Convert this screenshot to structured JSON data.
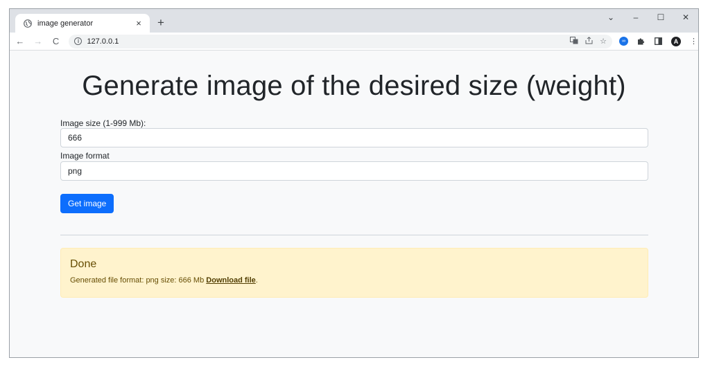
{
  "browser": {
    "tab": {
      "title": "image generator",
      "close": "×"
    },
    "new_tab": "+",
    "window_controls": {
      "dropdown": "⌄",
      "minimize": "–",
      "maximize": "☐",
      "close": "✕"
    },
    "nav": {
      "back": "←",
      "forward": "→",
      "reload": "C"
    },
    "url": "127.0.0.1",
    "profile_initial": "A"
  },
  "page": {
    "title": "Generate image of the desired size (weight)",
    "size_field": {
      "label": "Image size (1-999 Mb):",
      "value": "666"
    },
    "format_field": {
      "label": "Image format",
      "value": "png"
    },
    "submit_label": "Get image",
    "alert": {
      "heading": "Done",
      "text": "Generated file format: png size: 666 Mb",
      "link": "Download file",
      "suffix": "."
    }
  },
  "colors": {
    "primary": "#0d6efd",
    "alert_bg": "#fff3cd",
    "alert_text": "#664d03"
  }
}
